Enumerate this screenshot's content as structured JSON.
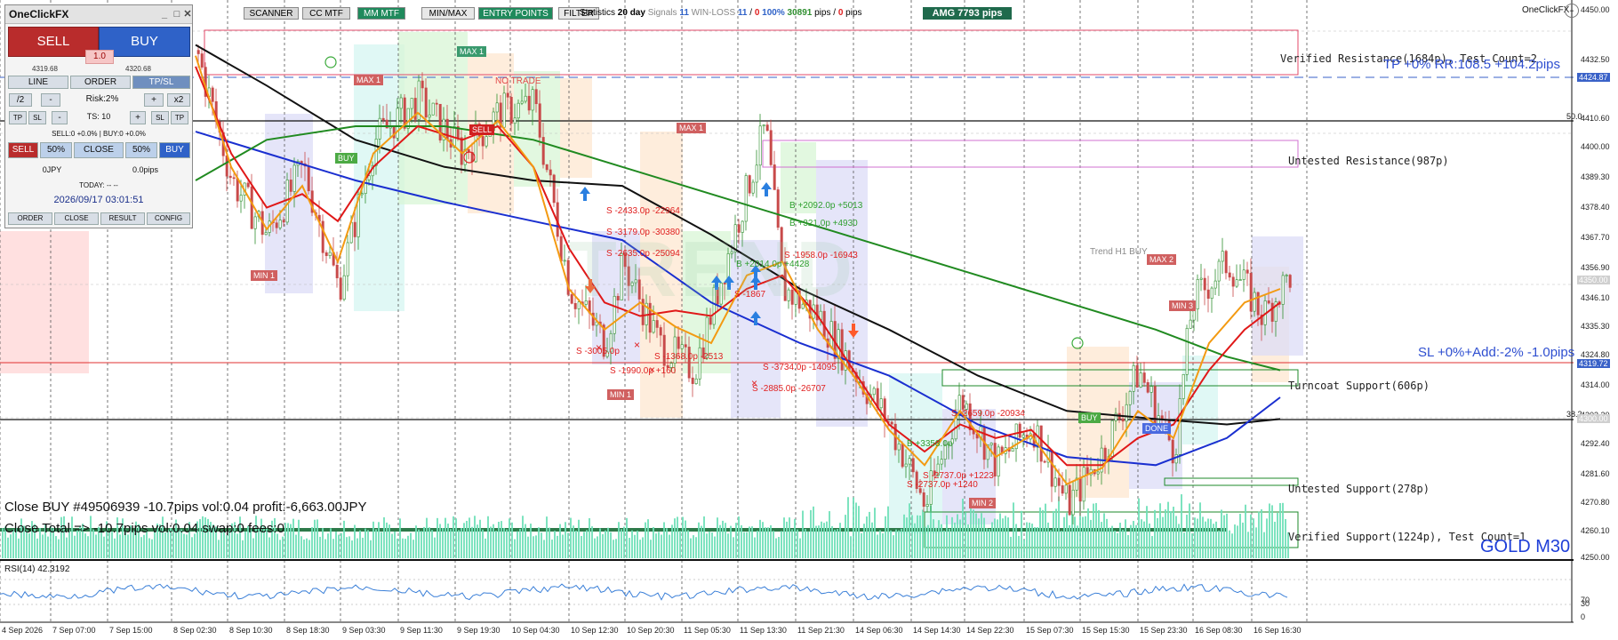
{
  "panel": {
    "title": "OneClickFX",
    "controls": [
      "_",
      "□",
      "✕"
    ],
    "sell_label": "SELL",
    "buy_label": "BUY",
    "lot": "1.0",
    "sell_price": "4319.68",
    "buy_price": "4320.68",
    "modes": [
      "LINE",
      "ORDER",
      "TP/SL"
    ],
    "row1": [
      "/2",
      "-",
      "Risk:2%",
      "+",
      "x2"
    ],
    "row2": [
      "TP",
      "SL",
      "-",
      "TS: 10",
      "+",
      "SL",
      "TP"
    ],
    "positions": "SELL:0 +0.0% | BUY:0 +0.0%",
    "row3": [
      "SELL",
      "50%",
      "CLOSE",
      "50%",
      "BUY"
    ],
    "pnl_left": "0JPY",
    "pnl_right": "0.0pips",
    "today": "TODAY: -- --",
    "datetime": "2026/09/17  03:01:51",
    "bottom_tabs": [
      "ORDER",
      "CLOSE",
      "RESULT",
      "CONFIG"
    ]
  },
  "topbar": {
    "buttons": [
      "SCANNER",
      "CC MTF",
      "MM MTF",
      "MIN/MAX",
      "ENTRY POINTS",
      "FILTER"
    ],
    "stats_prefix": "Statistics",
    "stats_days": "20 day",
    "signals_label": "Signals",
    "signals_value": "11",
    "winloss_label": "WIN-LOSS",
    "winloss_value": "11",
    "winloss_sep": "/",
    "winloss_zero": "0",
    "winrate": "100%",
    "pips_gain": "30891",
    "pips_unit": "pips",
    "pips_loss": "0",
    "amg_label": "AMG",
    "amg_value": "7793 pips"
  },
  "brand": "OneClickFX",
  "annotations": {
    "tp_line": "TP +0% RR:108.5 +104.2pips",
    "sl_line": "SL +0%+Add:-2% -1.0pips",
    "verified_resistance": "Verified Resistance(1684p), Test Count=2",
    "untested_resistance": "Untested Resistance(987p)",
    "turncoat_support": "Turncoat Support(606p)",
    "untested_support": "Untested Support(278p)",
    "verified_support": "Verified Support(1224p), Test Count=1",
    "symbol": "GOLD M30",
    "trend_text": "Trend H1 BUY",
    "no_trade": "NO TRADE",
    "watermark": "TREND",
    "close_buy": "Close BUY #49506939 -10.7pips vol:0.04 profit:-6,663.00JPY",
    "close_total": "Close Total =>  -10.7pips vol:0.04 swap:0 fees:0",
    "rsi_label": "RSI(14) 42.3192",
    "level_50": "50.0",
    "level_382": "38.2"
  },
  "tags": {
    "max1a": "MAX 1",
    "max1b": "MAX 1",
    "max1c": "MAX 1",
    "max2": "MAX 2",
    "min1a": "MIN 1",
    "min1b": "MIN 1",
    "min2": "MIN 2",
    "min3": "MIN 3",
    "sell": "SELL",
    "buy1": "BUY",
    "buy2": "BUY",
    "done": "DONE"
  },
  "price_axis": {
    "labels": [
      "4450.00",
      "4432.50",
      "4421.50",
      "4410.60",
      "4400.00",
      "4389.30",
      "4378.40",
      "4367.70",
      "4356.90",
      "4346.10",
      "4335.30",
      "4324.80",
      "4314.00",
      "4303.20",
      "4292.40",
      "4281.60",
      "4270.80",
      "4260.10",
      "4250.00"
    ],
    "tp_price": "4424.87",
    "current_price": "4319.72",
    "level_4350": "4350.00",
    "level_4300": "4300.00",
    "rsi_labels": [
      "70",
      "30",
      "0"
    ]
  },
  "time_axis": [
    "4 Sep 2026",
    "7 Sep 07:00",
    "7 Sep 15:00",
    "8 Sep 02:30",
    "8 Sep 10:30",
    "8 Sep 18:30",
    "9 Sep 03:30",
    "9 Sep 11:30",
    "9 Sep 19:30",
    "10 Sep 04:30",
    "10 Sep 12:30",
    "10 Sep 20:30",
    "11 Sep 05:30",
    "11 Sep 13:30",
    "11 Sep 21:30",
    "14 Sep 06:30",
    "14 Sep 14:30",
    "14 Sep 22:30",
    "15 Sep 07:30",
    "15 Sep 15:30",
    "15 Sep 23:30",
    "16 Sep 08:30",
    "16 Sep 16:30"
  ],
  "trade_labels": [
    "S -2433.0p -22964",
    "S -3179.0p -30380",
    "S -2635.0p -25094",
    "B +2092.0p +5013",
    "B +321.0p +4930",
    "S -1958.0p -16943",
    "B +2014.0p +4428",
    "S -1867",
    "S -3005.0p",
    "S -1368.0p -2513",
    "S -1990.0p +160",
    "S -3734.0p -14095",
    "S -2885.0p -26707",
    "S -2659.0p -20934",
    "B +3358.0p",
    "S -2737.0p +1223",
    "S -2737.0p +1240"
  ],
  "colors": {
    "bull": "#2f8f2f",
    "bear": "#c84a4a",
    "ma_red": "#e01818",
    "ma_orange": "#f39a12",
    "ma_green": "#208a20",
    "ma_blue": "#1a2fd0",
    "ma_black": "#111111",
    "volume": "#6fe0b8",
    "rsi": "#3a7fd8",
    "sell_btn": "#b92c2c",
    "buy_btn": "#2f62c8",
    "mmmtf": "#1f8a5c",
    "resistance": "#e34a6a",
    "support": "#1d8a2a"
  }
}
